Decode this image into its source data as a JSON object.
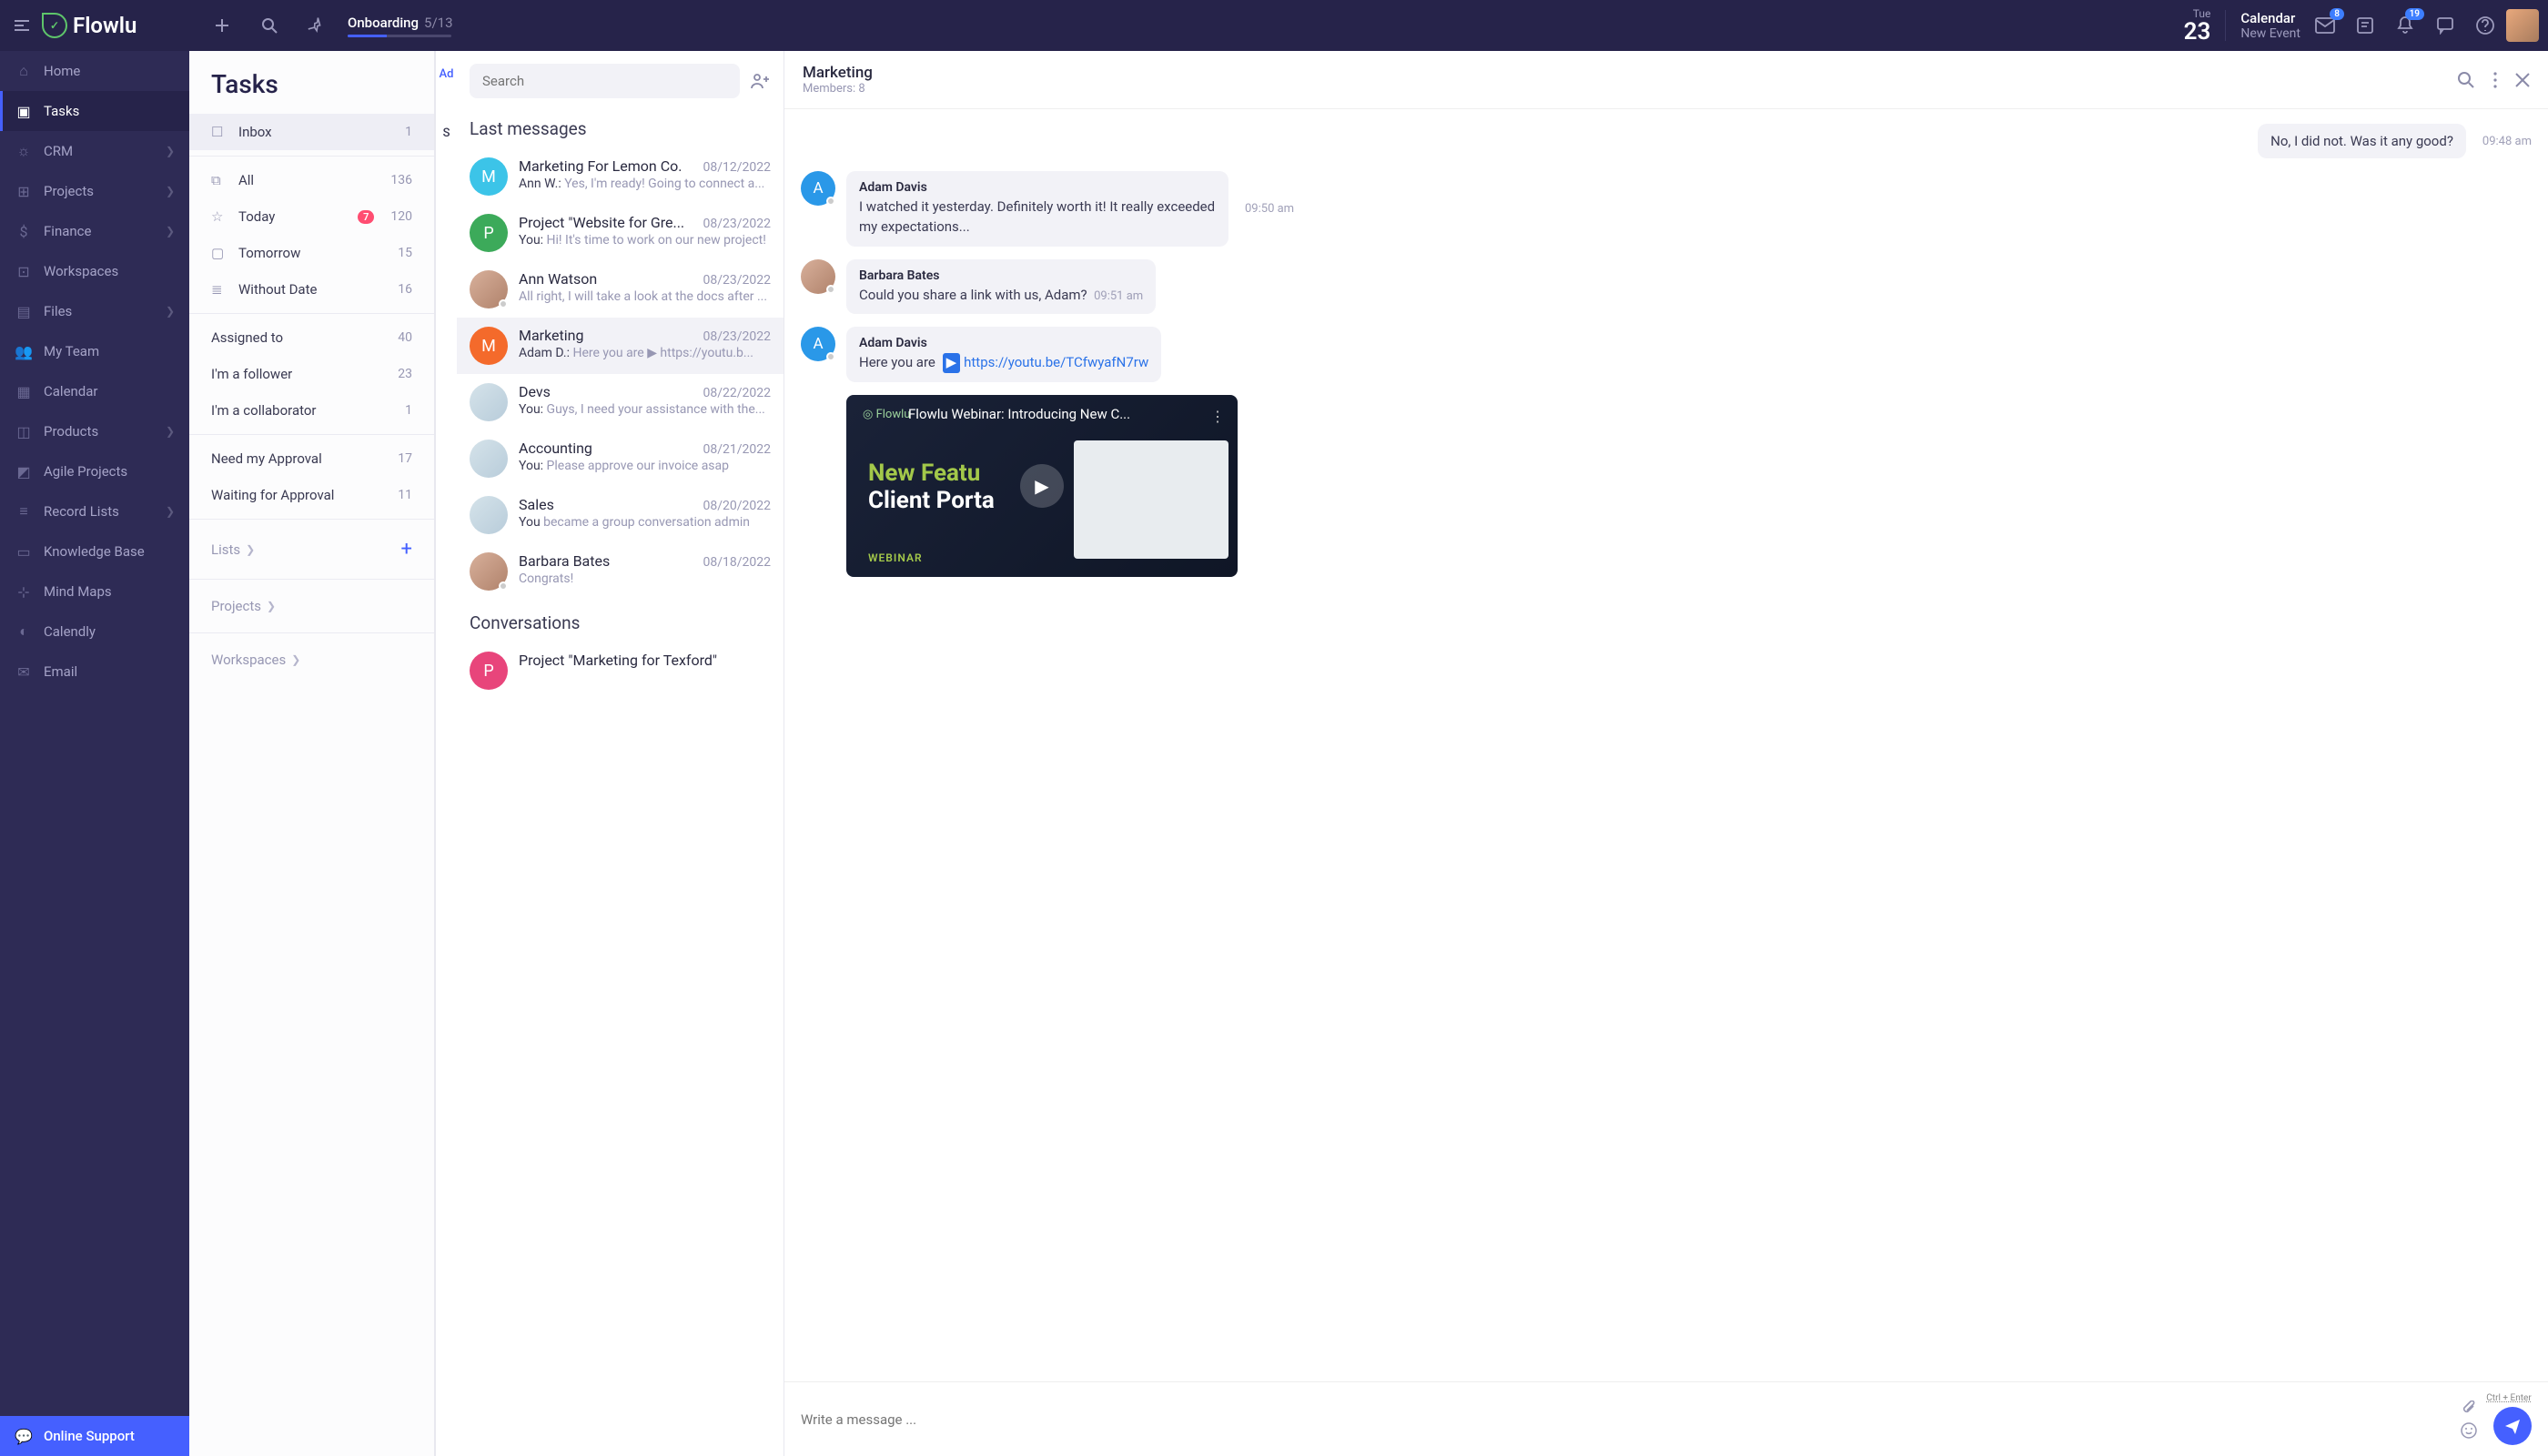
{
  "brand": "Flowlu",
  "onboarding": {
    "title": "Onboarding",
    "fraction": "5/13",
    "pct": 38
  },
  "date": {
    "weekday": "Tue",
    "day": "23"
  },
  "calendar": {
    "title": "Calendar",
    "sub": "New Event"
  },
  "badges": {
    "inbox": "8",
    "bell": "19"
  },
  "nav": [
    {
      "label": "Home",
      "icon": "⌂"
    },
    {
      "label": "Tasks",
      "icon": "▣",
      "active": true
    },
    {
      "label": "CRM",
      "icon": "☼",
      "chev": true
    },
    {
      "label": "Projects",
      "icon": "⊞",
      "chev": true
    },
    {
      "label": "Finance",
      "icon": "$",
      "chev": true
    },
    {
      "label": "Workspaces",
      "icon": "⊡"
    },
    {
      "label": "Files",
      "icon": "▤",
      "chev": true
    },
    {
      "label": "My Team",
      "icon": "👥"
    },
    {
      "label": "Calendar",
      "icon": "▦"
    },
    {
      "label": "Products",
      "icon": "◫",
      "chev": true
    },
    {
      "label": "Agile Projects",
      "icon": "◩"
    },
    {
      "label": "Record Lists",
      "icon": "≡",
      "chev": true
    },
    {
      "label": "Knowledge Base",
      "icon": "▭"
    },
    {
      "label": "Mind Maps",
      "icon": "⊹"
    },
    {
      "label": "Calendly",
      "icon": "◐"
    },
    {
      "label": "Email",
      "icon": "✉"
    }
  ],
  "support": "Online Support",
  "tasks": {
    "title": "Tasks",
    "rows1": [
      {
        "label": "Inbox",
        "count": "1",
        "icon": "☐",
        "sel": true
      }
    ],
    "rows2": [
      {
        "label": "All",
        "count": "136",
        "icon": "⧉"
      },
      {
        "label": "Today",
        "count": "120",
        "icon": "☆",
        "badge": "7"
      },
      {
        "label": "Tomorrow",
        "count": "15",
        "icon": "▢"
      },
      {
        "label": "Without Date",
        "count": "16",
        "icon": "≣"
      }
    ],
    "rows3": [
      {
        "label": "Assigned to",
        "count": "40"
      },
      {
        "label": "I'm a follower",
        "count": "23"
      },
      {
        "label": "I'm a collaborator",
        "count": "1"
      }
    ],
    "rows4": [
      {
        "label": "Need my Approval",
        "count": "17"
      },
      {
        "label": "Waiting for Approval",
        "count": "11"
      }
    ],
    "extras": [
      "Lists",
      "Projects",
      "Workspaces"
    ],
    "overflow": {
      "a": "Ad",
      "b": "S"
    }
  },
  "messages": {
    "search_ph": "Search",
    "section1": "Last messages",
    "section2": "Conversations",
    "items": [
      {
        "avatar": "M",
        "color": "#3cc4e8",
        "name": "Marketing For Lemon Co.",
        "date": "08/12/2022",
        "prefix": "Ann W.:",
        "preview": "Yes, I'm ready! Going to connect a..."
      },
      {
        "avatar": "P",
        "color": "#3caa5a",
        "name": "Project \"Website for Gre...",
        "date": "08/23/2022",
        "prefix": "You:",
        "preview": "Hi! It's time to work on our new project!"
      },
      {
        "avatar": "",
        "color": "photo",
        "name": "Ann Watson",
        "date": "08/23/2022",
        "prefix": "",
        "preview": "All right, I will take a look at the docs after ..."
      },
      {
        "avatar": "M",
        "color": "#f46a2b",
        "name": "Marketing",
        "date": "08/23/2022",
        "prefix": "Adam D.:",
        "preview": "Here you are ▶ https://youtu.b...",
        "sel": true
      },
      {
        "avatar": "",
        "color": "img1",
        "name": "Devs",
        "date": "08/22/2022",
        "prefix": "You:",
        "preview": "Guys, I need your assistance with the..."
      },
      {
        "avatar": "",
        "color": "img2",
        "name": "Accounting",
        "date": "08/21/2022",
        "prefix": "You:",
        "preview": "Please approve our invoice asap"
      },
      {
        "avatar": "",
        "color": "img3",
        "name": "Sales",
        "date": "08/20/2022",
        "prefix": "You",
        "preview": " became a group conversation admin"
      },
      {
        "avatar": "",
        "color": "photo",
        "name": "Barbara Bates",
        "date": "08/18/2022",
        "prefix": "",
        "preview": "Congrats!"
      }
    ],
    "conv": [
      {
        "avatar": "P",
        "color": "#e8457b",
        "name": "Project \"Marketing for Texford\""
      }
    ]
  },
  "chat": {
    "title": "Marketing",
    "members": "Members: 8",
    "msgs": [
      {
        "side": "right",
        "text": "No, I did not. Was it any good?",
        "time": "09:48 am"
      },
      {
        "side": "left",
        "sender": "Adam Davis",
        "avatar": "A",
        "color": "#2a98e8",
        "text": "I watched it yesterday. Definitely worth it! It really exceeded my expectations...",
        "time": "09:50 am"
      },
      {
        "side": "left",
        "sender": "Barbara Bates",
        "avatar": "",
        "color": "photo",
        "text": "Could you share a link with us, Adam?",
        "time": "09:51 am",
        "inline_time": true
      },
      {
        "side": "left",
        "sender": "Adam Davis",
        "avatar": "A",
        "color": "#2a98e8",
        "text": "Here you are ",
        "link": "https://youtu.be/TCfwyafN7rw",
        "icon": "▶"
      }
    ],
    "video": {
      "title": "Flowlu Webinar: Introducing New C...",
      "feature1": "New Featu",
      "feature2": "Client Porta",
      "tag": "WEBINAR"
    },
    "compose_ph": "Write a message ...",
    "hint": "Ctrl + Enter"
  }
}
